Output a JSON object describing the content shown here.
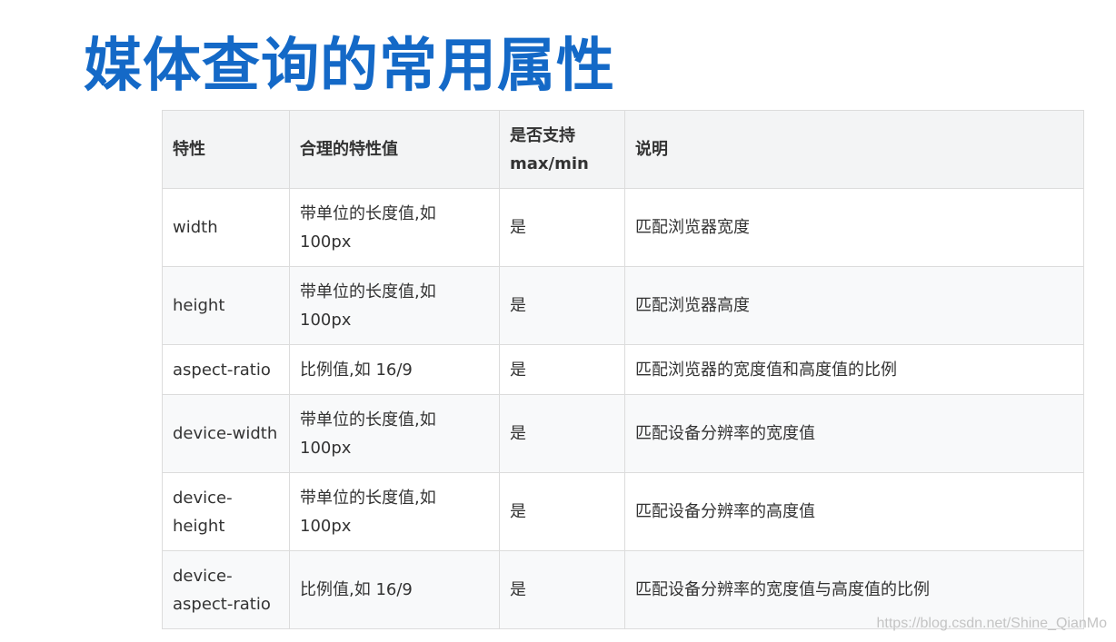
{
  "title": "媒体查询的常用属性",
  "table": {
    "headers": [
      "特性",
      "合理的特性值",
      "是否支持\nmax/min",
      "说明"
    ],
    "rows": [
      [
        "width",
        "带单位的长度值,如\n100px",
        "是",
        "匹配浏览器宽度"
      ],
      [
        "height",
        "带单位的长度值,如\n100px",
        "是",
        "匹配浏览器高度"
      ],
      [
        "aspect-ratio",
        "比例值,如 16/9",
        "是",
        "匹配浏览器的宽度值和高度值的比例"
      ],
      [
        "device-width",
        "带单位的长度值,如\n100px",
        "是",
        "匹配设备分辨率的宽度值"
      ],
      [
        "device-\nheight",
        "带单位的长度值,如\n100px",
        "是",
        "匹配设备分辨率的高度值"
      ],
      [
        "device-\naspect-ratio",
        "比例值,如 16/9",
        "是",
        "匹配设备分辨率的宽度值与高度值的比例"
      ]
    ]
  },
  "watermark": "https://blog.csdn.net/Shine_QianMo"
}
